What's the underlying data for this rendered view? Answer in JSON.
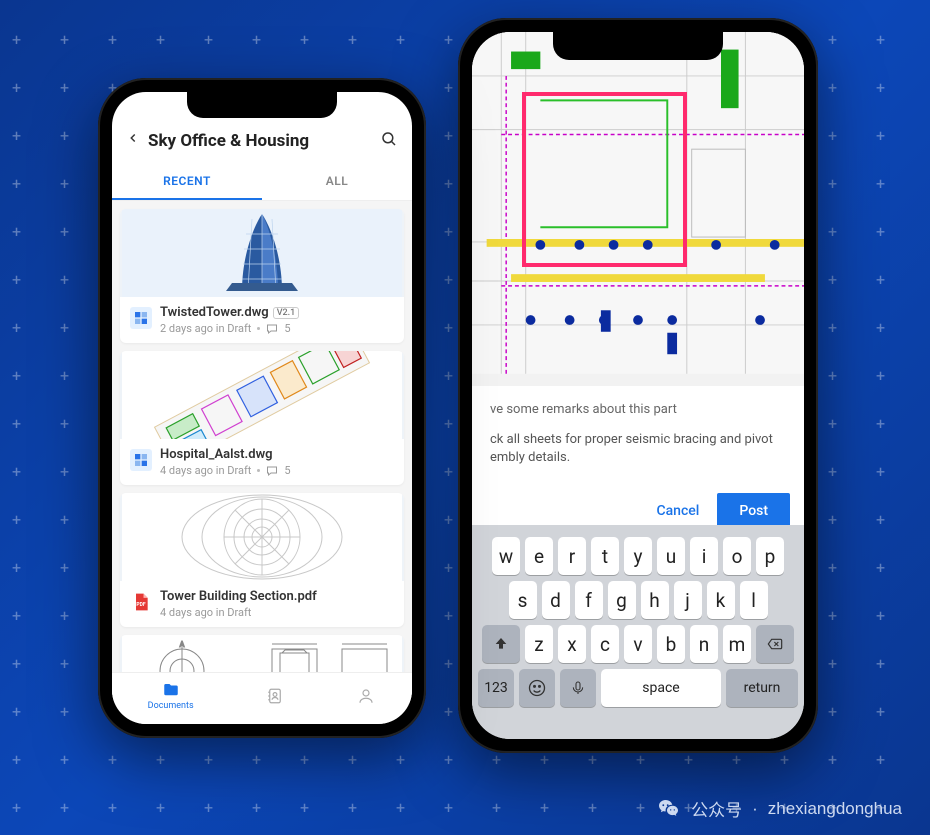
{
  "phone1": {
    "title": "Sky Office & Housing",
    "tabs": {
      "recent": "RECENT",
      "all": "ALL"
    },
    "files": [
      {
        "name": "TwistedTower.dwg",
        "version": "V2.1",
        "meta": "2 days ago in Draft",
        "comments": "5",
        "type": "dwg"
      },
      {
        "name": "Hospital_Aalst.dwg",
        "version": "",
        "meta": "4 days ago in Draft",
        "comments": "5",
        "type": "dwg"
      },
      {
        "name": "Tower Building Section.pdf",
        "version": "",
        "meta": "4 days ago in Draft",
        "comments": "",
        "type": "pdf"
      }
    ],
    "tabbar": {
      "documents": "Documents"
    }
  },
  "phone2": {
    "comment_header": "ve some remarks about this part",
    "comment_body": "ck all sheets for proper seismic bracing and pivot embly details.",
    "cancel": "Cancel",
    "post": "Post",
    "keyboard": {
      "row1": [
        "w",
        "e",
        "r",
        "t",
        "y",
        "u",
        "i",
        "o",
        "p"
      ],
      "row2": [
        "s",
        "d",
        "f",
        "g",
        "h",
        "j",
        "k",
        "l"
      ],
      "row3": [
        "z",
        "x",
        "c",
        "v",
        "b",
        "n",
        "m"
      ],
      "space": "space",
      "return": "return",
      "numbers": "123"
    }
  },
  "watermark": {
    "label": "公众号",
    "sep": "·",
    "name": "zhexiangdonghua"
  }
}
